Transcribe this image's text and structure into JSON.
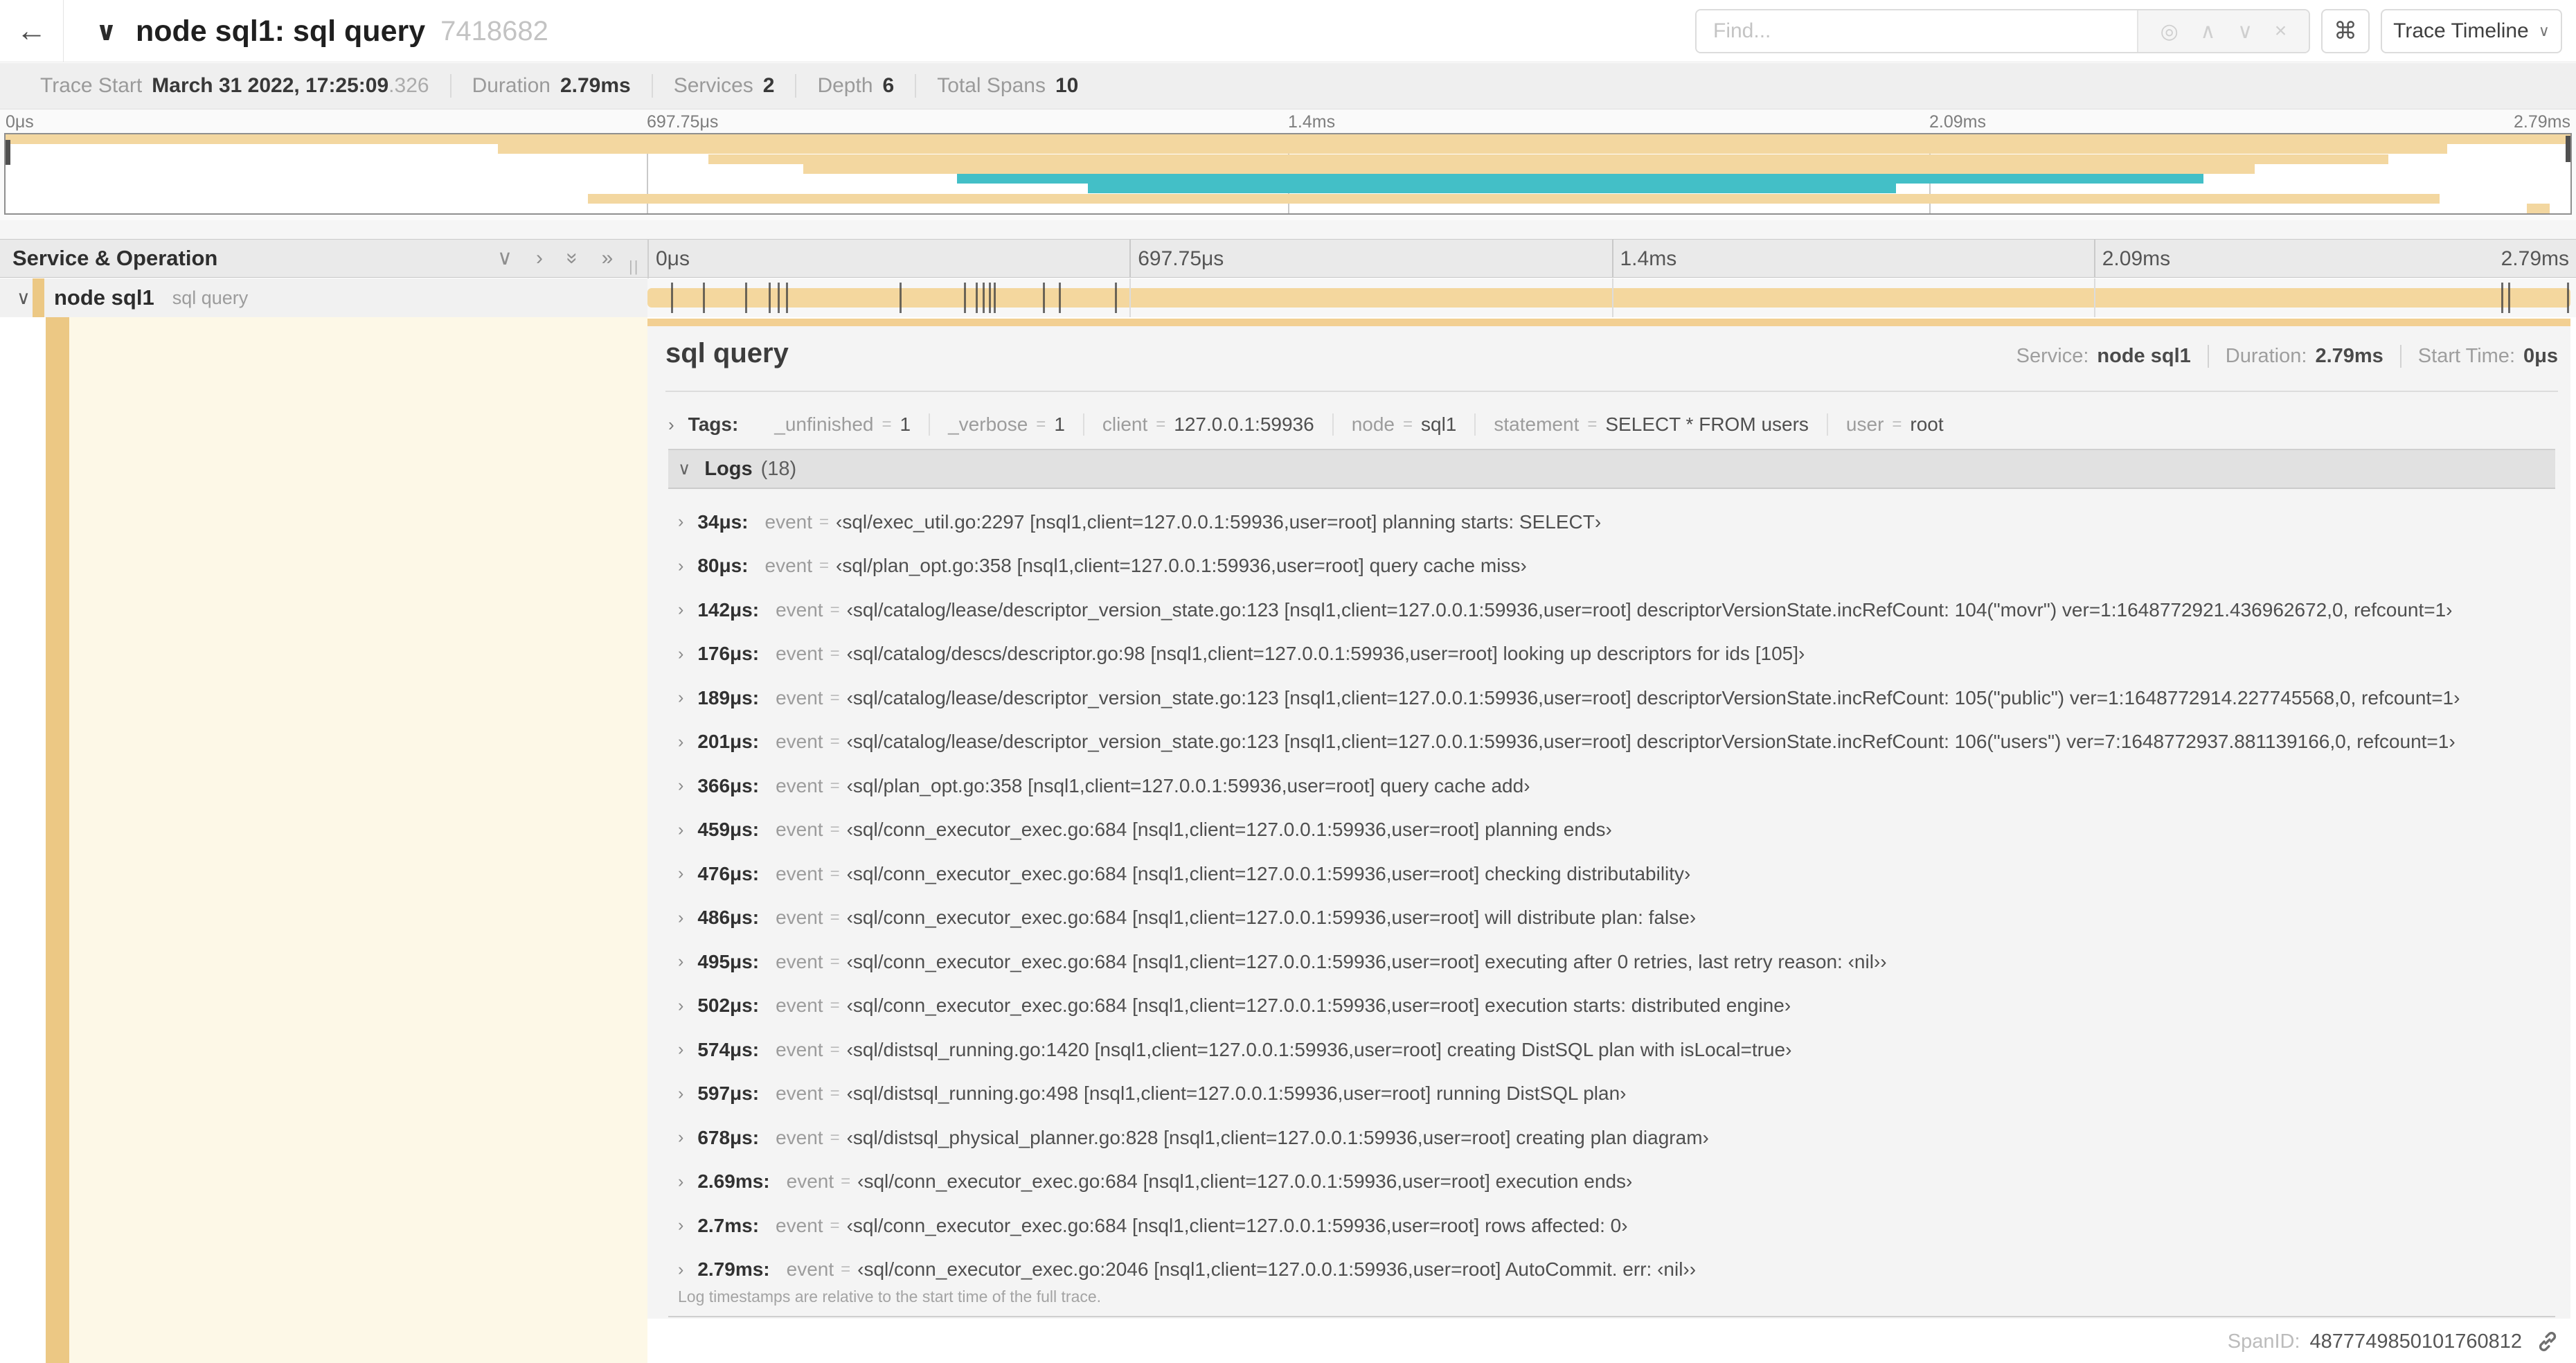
{
  "colors": {
    "tan": "#f3d7a0",
    "tan_strip": "#ecc884",
    "teal": "#43bfc7",
    "cream": "#fdf8e7",
    "panel_bg": "#f4f4f4",
    "accent": "#f2cf92",
    "scrubber": "#4f4f4f"
  },
  "header": {
    "back_icon": "←",
    "collapse_chevron": "∨",
    "title": "node sql1: sql query",
    "trace_id": "7418682",
    "find_placeholder": "Find...",
    "find_tools": [
      "◎",
      "∧",
      "∨",
      "×"
    ],
    "shortcut_button": "⌘",
    "view_button": "Trace Timeline",
    "view_button_chevron": "∨"
  },
  "meta": {
    "items": [
      {
        "label": "Trace Start",
        "value": "March 31 2022, 17:25:09",
        "suffix": ".326"
      },
      {
        "label": "Duration",
        "value": "2.79ms"
      },
      {
        "label": "Services",
        "value": "2"
      },
      {
        "label": "Depth",
        "value": "6"
      },
      {
        "label": "Total Spans",
        "value": "10"
      }
    ]
  },
  "timeline": {
    "duration_us": 2790,
    "axis_ticks": [
      {
        "label": "0μs",
        "pos": 0
      },
      {
        "label": "697.75μs",
        "pos": 0.25
      },
      {
        "label": "1.4ms",
        "pos": 0.5
      },
      {
        "label": "2.09ms",
        "pos": 0.75
      },
      {
        "label": "2.79ms",
        "pos": 1
      }
    ],
    "minimap_spans": [
      {
        "start": 0,
        "end": 100,
        "color": "tan"
      },
      {
        "start": 19.2,
        "end": 95.2,
        "color": "tan"
      },
      {
        "start": 27.4,
        "end": 92.9,
        "color": "tan"
      },
      {
        "start": 31.1,
        "end": 87.7,
        "color": "tan"
      },
      {
        "start": 37.1,
        "end": 85.7,
        "color": "teal"
      },
      {
        "start": 42.2,
        "end": 73.7,
        "color": "teal"
      },
      {
        "start": 22.7,
        "end": 94.9,
        "color": "tan"
      },
      {
        "start": 98.3,
        "end": 99.2,
        "color": "tan"
      }
    ],
    "log_marks_us": [
      34,
      80,
      142,
      176,
      189,
      201,
      366,
      459,
      476,
      486,
      495,
      502,
      574,
      597,
      678,
      2690,
      2700,
      2790
    ],
    "left_header": "Service & Operation",
    "row": {
      "chevron": "∨",
      "service": "node sql1",
      "operation": "sql query"
    }
  },
  "detail": {
    "title": "sql query",
    "overview": [
      {
        "label": "Service:",
        "value": "node sql1"
      },
      {
        "label": "Duration:",
        "value": "2.79ms"
      },
      {
        "label": "Start Time:",
        "value": "0μs"
      }
    ],
    "tags_chevron": "›",
    "tags_header": "Tags:",
    "tags": [
      {
        "key": "_unfinished",
        "value": "1"
      },
      {
        "key": "_verbose",
        "value": "1"
      },
      {
        "key": "client",
        "value": "127.0.0.1:59936"
      },
      {
        "key": "node",
        "value": "sql1"
      },
      {
        "key": "statement",
        "value": "SELECT * FROM users"
      },
      {
        "key": "user",
        "value": "root"
      }
    ],
    "logs_chevron": "∨",
    "logs_header": "Logs",
    "logs_count": "(18)",
    "log_key": "event",
    "logs": [
      {
        "time": "34μs:",
        "value": "‹sql/exec_util.go:2297 [nsql1,client=127.0.0.1:59936,user=root] planning starts: SELECT›"
      },
      {
        "time": "80μs:",
        "value": "‹sql/plan_opt.go:358 [nsql1,client=127.0.0.1:59936,user=root] query cache miss›"
      },
      {
        "time": "142μs:",
        "value": "‹sql/catalog/lease/descriptor_version_state.go:123 [nsql1,client=127.0.0.1:59936,user=root] descriptorVersionState.incRefCount: 104(\"movr\") ver=1:1648772921.436962672,0, refcount=1›"
      },
      {
        "time": "176μs:",
        "value": "‹sql/catalog/descs/descriptor.go:98 [nsql1,client=127.0.0.1:59936,user=root] looking up descriptors for ids [105]›"
      },
      {
        "time": "189μs:",
        "value": "‹sql/catalog/lease/descriptor_version_state.go:123 [nsql1,client=127.0.0.1:59936,user=root] descriptorVersionState.incRefCount: 105(\"public\") ver=1:1648772914.227745568,0, refcount=1›"
      },
      {
        "time": "201μs:",
        "value": "‹sql/catalog/lease/descriptor_version_state.go:123 [nsql1,client=127.0.0.1:59936,user=root] descriptorVersionState.incRefCount: 106(\"users\") ver=7:1648772937.881139166,0, refcount=1›"
      },
      {
        "time": "366μs:",
        "value": "‹sql/plan_opt.go:358 [nsql1,client=127.0.0.1:59936,user=root] query cache add›"
      },
      {
        "time": "459μs:",
        "value": "‹sql/conn_executor_exec.go:684 [nsql1,client=127.0.0.1:59936,user=root] planning ends›"
      },
      {
        "time": "476μs:",
        "value": "‹sql/conn_executor_exec.go:684 [nsql1,client=127.0.0.1:59936,user=root] checking distributability›"
      },
      {
        "time": "486μs:",
        "value": "‹sql/conn_executor_exec.go:684 [nsql1,client=127.0.0.1:59936,user=root] will distribute plan: false›"
      },
      {
        "time": "495μs:",
        "value": "‹sql/conn_executor_exec.go:684 [nsql1,client=127.0.0.1:59936,user=root] executing after 0 retries, last retry reason: ‹nil››"
      },
      {
        "time": "502μs:",
        "value": "‹sql/conn_executor_exec.go:684 [nsql1,client=127.0.0.1:59936,user=root] execution starts: distributed engine›"
      },
      {
        "time": "574μs:",
        "value": "‹sql/distsql_running.go:1420 [nsql1,client=127.0.0.1:59936,user=root] creating DistSQL plan with isLocal=true›"
      },
      {
        "time": "597μs:",
        "value": "‹sql/distsql_running.go:498 [nsql1,client=127.0.0.1:59936,user=root] running DistSQL plan›"
      },
      {
        "time": "678μs:",
        "value": "‹sql/distsql_physical_planner.go:828 [nsql1,client=127.0.0.1:59936,user=root] creating plan diagram›"
      },
      {
        "time": "2.69ms:",
        "value": "‹sql/conn_executor_exec.go:684 [nsql1,client=127.0.0.1:59936,user=root] execution ends›"
      },
      {
        "time": "2.7ms:",
        "value": "‹sql/conn_executor_exec.go:684 [nsql1,client=127.0.0.1:59936,user=root] rows affected: 0›"
      },
      {
        "time": "2.79ms:",
        "value": "‹sql/conn_executor_exec.go:2046 [nsql1,client=127.0.0.1:59936,user=root] AutoCommit. err: ‹nil››"
      }
    ],
    "logs_note": "Log timestamps are relative to the start time of the full trace.",
    "spanid_label": "SpanID:",
    "spanid_value": "4877749850101760812"
  }
}
